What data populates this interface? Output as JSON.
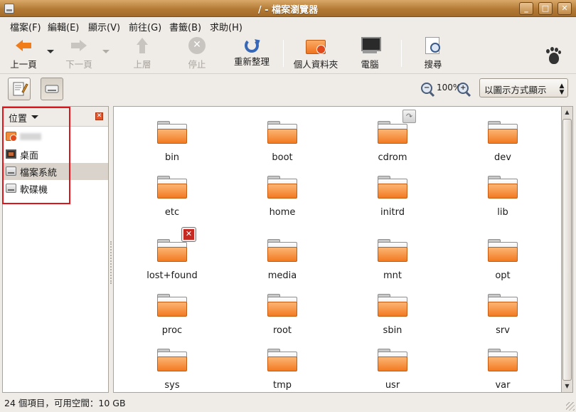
{
  "window": {
    "title": "/ - 檔案瀏覽器",
    "minimize_glyph": "_",
    "maximize_glyph": "□",
    "close_glyph": "✕"
  },
  "menubar": {
    "items": [
      "檔案(F)",
      "編輯(E)",
      "顯示(V)",
      "前往(G)",
      "書籤(B)",
      "求助(H)"
    ]
  },
  "toolbar": {
    "back": "上一頁",
    "forward": "下一頁",
    "up": "上層",
    "stop": "停止",
    "reload": "重新整理",
    "home": "個人資料夾",
    "computer": "電腦",
    "search": "搜尋"
  },
  "locationbar": {
    "zoom": "100%",
    "zoom_out_glyph": "−",
    "zoom_in_glyph": "+",
    "view_mode": "以圖示方式顯示",
    "view_mode_arrows": "▲▼"
  },
  "sidebar": {
    "title": "位置",
    "close_glyph": "✕",
    "items": [
      {
        "label": "",
        "icon": "home-folder-icon"
      },
      {
        "label": "桌面",
        "icon": "desktop-icon"
      },
      {
        "label": "檔案系統",
        "icon": "drive-icon"
      },
      {
        "label": "軟碟機",
        "icon": "floppy-icon"
      }
    ]
  },
  "scrollbar": {
    "up_glyph": "▲",
    "down_glyph": "▼"
  },
  "files": [
    "bin",
    "boot",
    "cdrom",
    "dev",
    "etc",
    "home",
    "initrd",
    "lib",
    "lost+found",
    "media",
    "mnt",
    "opt",
    "proc",
    "root",
    "sbin",
    "srv",
    "sys",
    "tmp",
    "usr",
    "var"
  ],
  "emblems": {
    "link_glyph": "↷",
    "noaccess_glyph": "✕"
  },
  "statusbar": {
    "text": "24 個項目，可用空間：10 GB"
  },
  "colors": {
    "titlebar": "#b37a35",
    "folder_orange": "#f27a22",
    "highlight": "#e0151b"
  }
}
